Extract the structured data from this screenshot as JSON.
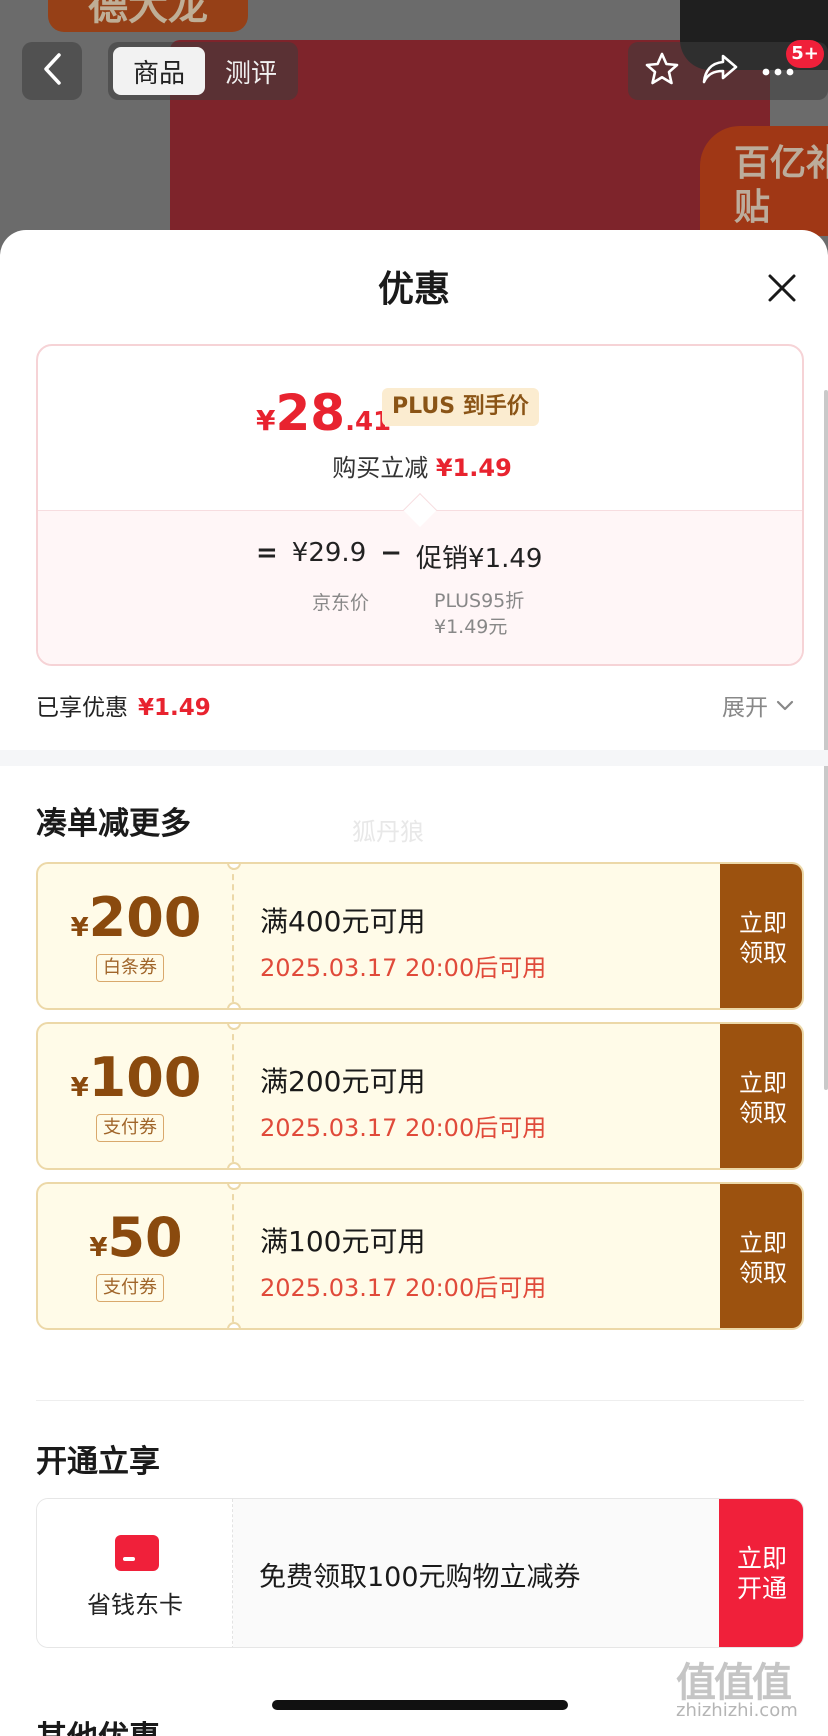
{
  "header": {
    "back_icon": "chevron-left-icon",
    "tabs": [
      {
        "label": "商品",
        "active": true
      },
      {
        "label": "测评",
        "active": false
      }
    ],
    "favorite_icon": "star-icon",
    "share_icon": "share-icon",
    "more_icon": "more-dots-icon",
    "message_count": "5+",
    "hero_tag_text": "德大龙",
    "subsidy_badge": "百亿补贴"
  },
  "sheet": {
    "title": "优惠",
    "close_icon": "close-icon"
  },
  "price": {
    "currency": "¥",
    "integer": "28",
    "decimal": ".41",
    "plus_tag": "PLUS 到手价",
    "instant_cut_label": "购买立减",
    "instant_cut_value": "¥1.49",
    "equals": "=",
    "jd_price": "¥29.9",
    "minus": "−",
    "promo": "促销¥1.49",
    "jd_price_label": "京东价",
    "promo_detail_1": "PLUS95折",
    "promo_detail_2": "¥1.49元"
  },
  "enjoyed": {
    "label": "已享优惠",
    "value": "¥1.49",
    "expand_label": "展开",
    "expand_icon": "chevron-down-icon"
  },
  "bundle": {
    "title": "凑单减更多",
    "watermark": "狐丹狼",
    "coupons": [
      {
        "currency": "¥",
        "amount": "200",
        "kind": "白条券",
        "condition": "满400元可用",
        "time": "2025.03.17 20:00后可用",
        "action": "立即\n领取"
      },
      {
        "currency": "¥",
        "amount": "100",
        "kind": "支付券",
        "condition": "满200元可用",
        "time": "2025.03.17 20:00后可用",
        "action": "立即\n领取"
      },
      {
        "currency": "¥",
        "amount": "50",
        "kind": "支付券",
        "condition": "满100元可用",
        "time": "2025.03.17 20:00后可用",
        "action": "立即\n领取"
      }
    ]
  },
  "membership": {
    "title": "开通立享",
    "card_icon": "card-icon",
    "card_name": "省钱东卡",
    "description": "免费领取100元购物立减券",
    "action": "立即\n开通"
  },
  "other": {
    "title": "其他优惠"
  },
  "site_watermark": {
    "mark": "值值值",
    "url": "zhizhizhi.com"
  },
  "colors": {
    "price_red": "#e8232f",
    "coupon_brown": "#9c520f",
    "coupon_bg": "#fffbe8",
    "open_red": "#f0203a"
  }
}
